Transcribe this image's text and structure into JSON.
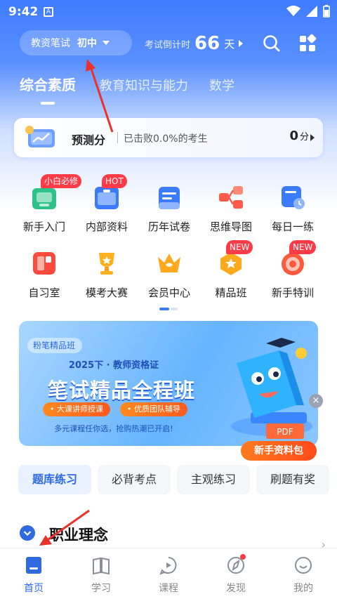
{
  "status_bar": {
    "time": "9:42",
    "notif_glyph": "A",
    "icons": [
      "wifi-icon",
      "signal-icon",
      "battery-icon"
    ]
  },
  "header": {
    "exam_type": "教资笔试",
    "level": "初中",
    "countdown_label": "考试倒计时",
    "countdown_days": "66",
    "countdown_unit": "天",
    "actions": [
      "search-icon",
      "apps-icon"
    ]
  },
  "subject_tabs": [
    {
      "label": "综合素质",
      "active": true
    },
    {
      "label": "教育知识与能力",
      "active": false
    },
    {
      "label": "数学",
      "active": false
    }
  ],
  "prediction": {
    "title": "预测分",
    "beat_text": "已击败0.0%的考生",
    "score": "0",
    "score_unit": "分"
  },
  "grid": [
    {
      "label": "新手入门",
      "icon": "newbie-icon",
      "badge": "小白必修"
    },
    {
      "label": "内部资料",
      "icon": "folder-icon",
      "badge": "HOT"
    },
    {
      "label": "历年试卷",
      "icon": "paper-icon",
      "badge": ""
    },
    {
      "label": "思维导图",
      "icon": "mindmap-icon",
      "badge": ""
    },
    {
      "label": "每日一练",
      "icon": "daily-icon",
      "badge": ""
    },
    {
      "label": "自习室",
      "icon": "study-room-icon",
      "badge": ""
    },
    {
      "label": "模考大赛",
      "icon": "trophy-icon",
      "badge": ""
    },
    {
      "label": "会员中心",
      "icon": "crown-icon",
      "badge": ""
    },
    {
      "label": "精品班",
      "icon": "medal-icon",
      "badge": "NEW"
    },
    {
      "label": "新手特训",
      "icon": "target-icon",
      "badge": "NEW"
    }
  ],
  "banner": {
    "brand": "粉笔精品班",
    "subtitle": "2025下 · 教师资格证",
    "headline": "笔试精品全程班",
    "pills": [
      "• 大课讲师授课",
      "• 优质团队辅导"
    ],
    "note": "多元课程任你选，抢购热潮已开启!",
    "pdf_label": "PDF",
    "close_glyph": "×",
    "cta": "新手资料包"
  },
  "practice_tabs": [
    {
      "label": "题库练习",
      "active": true
    },
    {
      "label": "必背考点",
      "active": false
    },
    {
      "label": "主观练习",
      "active": false
    },
    {
      "label": "刷题有奖",
      "active": false
    }
  ],
  "section": {
    "title": "职业理念",
    "more_glyph": "›"
  },
  "tab_bar": [
    {
      "label": "首页",
      "icon": "home-icon",
      "active": true,
      "dot": false
    },
    {
      "label": "学习",
      "icon": "study-icon",
      "active": false,
      "dot": false
    },
    {
      "label": "课程",
      "icon": "course-icon",
      "active": false,
      "dot": false
    },
    {
      "label": "发现",
      "icon": "discover-icon",
      "active": false,
      "dot": true
    },
    {
      "label": "我的",
      "icon": "profile-icon",
      "active": false,
      "dot": false
    }
  ],
  "colors": {
    "accent": "#2f6ae0",
    "badge": "#ff3b48",
    "cta": "#ff5a1e",
    "annotation": "#e8322a"
  }
}
